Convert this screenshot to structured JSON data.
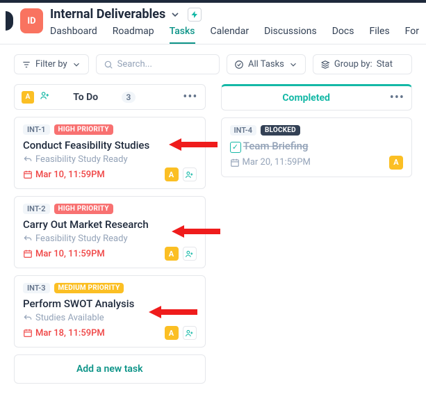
{
  "project": {
    "icon_text": "ID",
    "title": "Internal Deliverables"
  },
  "tabs": [
    "Dashboard",
    "Roadmap",
    "Tasks",
    "Calendar",
    "Discussions",
    "Docs",
    "Files",
    "For"
  ],
  "active_tab": "Tasks",
  "toolbar": {
    "filter_label": "Filter by",
    "search_placeholder": "Search...",
    "alltasks_label": "All Tasks",
    "groupby_label": "Group by:",
    "groupby_value": "Stat"
  },
  "columns": {
    "todo": {
      "title": "To Do",
      "count": "3",
      "badge": "A"
    },
    "completed": {
      "title": "Completed"
    }
  },
  "cards": {
    "c1": {
      "id": "INT-1",
      "priority": "HIGH PRIORITY",
      "title": "Conduct Feasibility Studies",
      "sub": "Feasibility Study Ready",
      "due": "Mar 10, 11:59PM",
      "badge": "A"
    },
    "c2": {
      "id": "INT-2",
      "priority": "HIGH PRIORITY",
      "title": "Carry Out Market Research",
      "sub": "Feasibility Study Ready",
      "due": "Mar 10, 11:59PM",
      "badge": "A"
    },
    "c3": {
      "id": "INT-3",
      "priority": "MEDIUM PRIORITY",
      "title": "Perform SWOT Analysis",
      "sub": "Studies Available",
      "due": "Mar 18, 11:59PM",
      "badge": "A"
    },
    "c4": {
      "id": "INT-4",
      "priority": "BLOCKED",
      "title": "Team Briefing",
      "due": "Mar 20, 11:59PM",
      "badge": "A"
    }
  },
  "add_task_label": "Add a new task"
}
